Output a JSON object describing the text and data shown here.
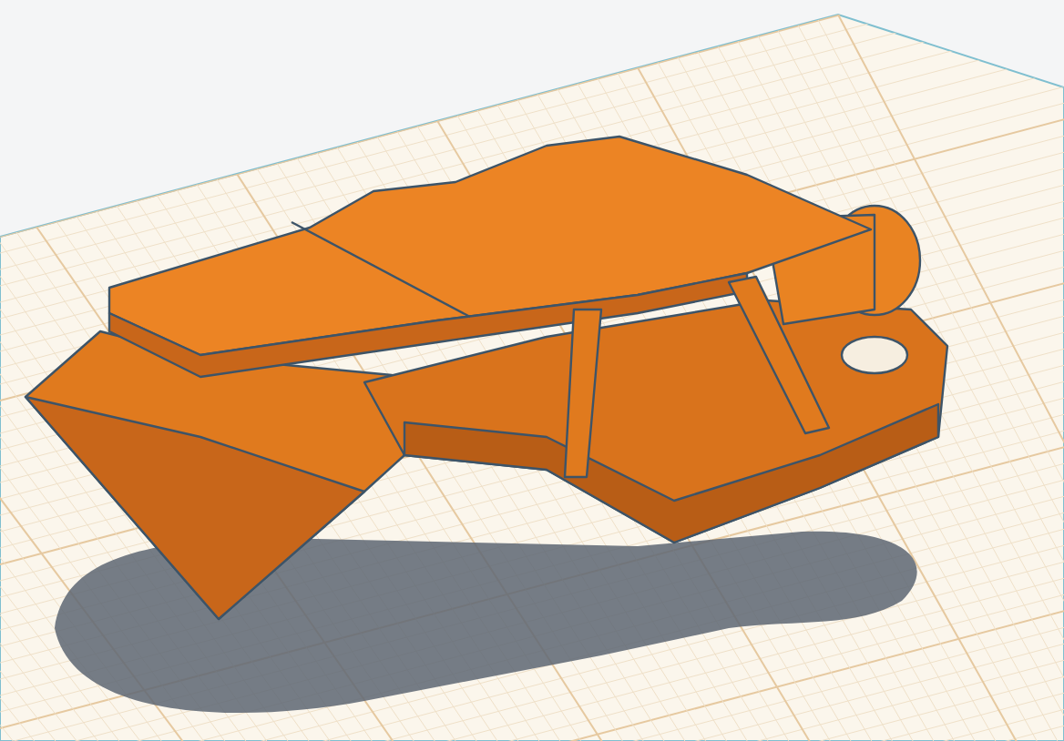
{
  "workplane": {
    "grid_visible": true,
    "shadow_visible": true
  }
}
